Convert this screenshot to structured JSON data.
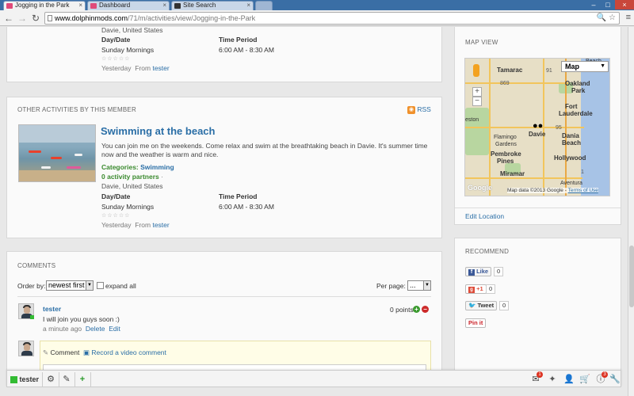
{
  "browser": {
    "tabs": [
      {
        "title": "Jogging in the Park",
        "active": true
      },
      {
        "title": "Dashboard",
        "active": false
      },
      {
        "title": "Site Search",
        "active": false
      }
    ],
    "url_host": "www.dolphinmods.com",
    "url_path": "/71/m/activities/view/Jogging-in-the-Park"
  },
  "top_activity": {
    "location": "Davie, United States",
    "daydate_label": "Day/Date",
    "daydate_value": "Sunday Mornings",
    "time_label": "Time Period",
    "time_value": "6:00 AM - 8:30 AM",
    "stars": "☆☆☆☆☆",
    "when": "Yesterday",
    "from_label": "From",
    "author": "tester"
  },
  "other_activities": {
    "heading": "OTHER ACTIVITIES BY THIS MEMBER",
    "rss_label": "RSS",
    "item": {
      "title": "Swimming at the beach",
      "description": "You can join me on the weekends. Come relax and swim at the breathtaking beach in Davie. It's summer time now and the weather is warm and nice.",
      "categories_label": "Categories:",
      "category": "Swimming",
      "partners": "0 activity partners",
      "partners_suffix": "·",
      "location": "Davie, United States",
      "daydate_label": "Day/Date",
      "daydate_value": "Sunday Mornings",
      "time_label": "Time Period",
      "time_value": "6:00 AM - 8:30 AM",
      "stars": "☆☆☆☆☆",
      "when": "Yesterday",
      "from_label": "From",
      "author": "tester"
    }
  },
  "map_view": {
    "heading": "MAP VIEW",
    "map_type": "Map",
    "footer_data": "Map data ©2013 Google",
    "footer_terms": "Terms of Use",
    "google_logo": "Google",
    "edit_location": "Edit Location",
    "labels": {
      "tamarac": "Tamarac",
      "oakland": "Oakland",
      "park": "Park",
      "fort": "Fort",
      "lauderdale": "Lauderdale",
      "weston": "eston",
      "flamingo": "Flamingo",
      "gardens": "Gardens",
      "davie": "Davie",
      "dania": "Dania",
      "beach": "Beach",
      "pembroke": "Pembroke",
      "pines": "Pines",
      "hollywood": "Hollywood",
      "miramar": "Miramar",
      "aventura": "Aventura",
      "beach_top": "Beach",
      "r869": "869",
      "r91": "91",
      "r95": "95",
      "r1": "1"
    }
  },
  "recommend": {
    "heading": "RECOMMEND",
    "like_label": "Like",
    "like_count": "0",
    "plusone_label": "+1",
    "plusone_count": "0",
    "tweet_label": "Tweet",
    "tweet_count": "0",
    "pinit_label": "Pin it"
  },
  "comments": {
    "heading": "COMMENTS",
    "order_label": "Order by:",
    "order_value": "newest first",
    "expand_label": "expand all",
    "perpage_label": "Per page:",
    "perpage_value": "...",
    "comment": {
      "author": "tester",
      "points": "0 points",
      "text": "I will join you guys soon :)",
      "when": "a minute ago",
      "delete": "Delete",
      "edit": "Edit"
    },
    "post_tab_comment": "Comment",
    "post_tab_video": "Record a video comment"
  },
  "bottombar": {
    "user": "tester",
    "mail_badge": "1",
    "info_badge": "3"
  }
}
